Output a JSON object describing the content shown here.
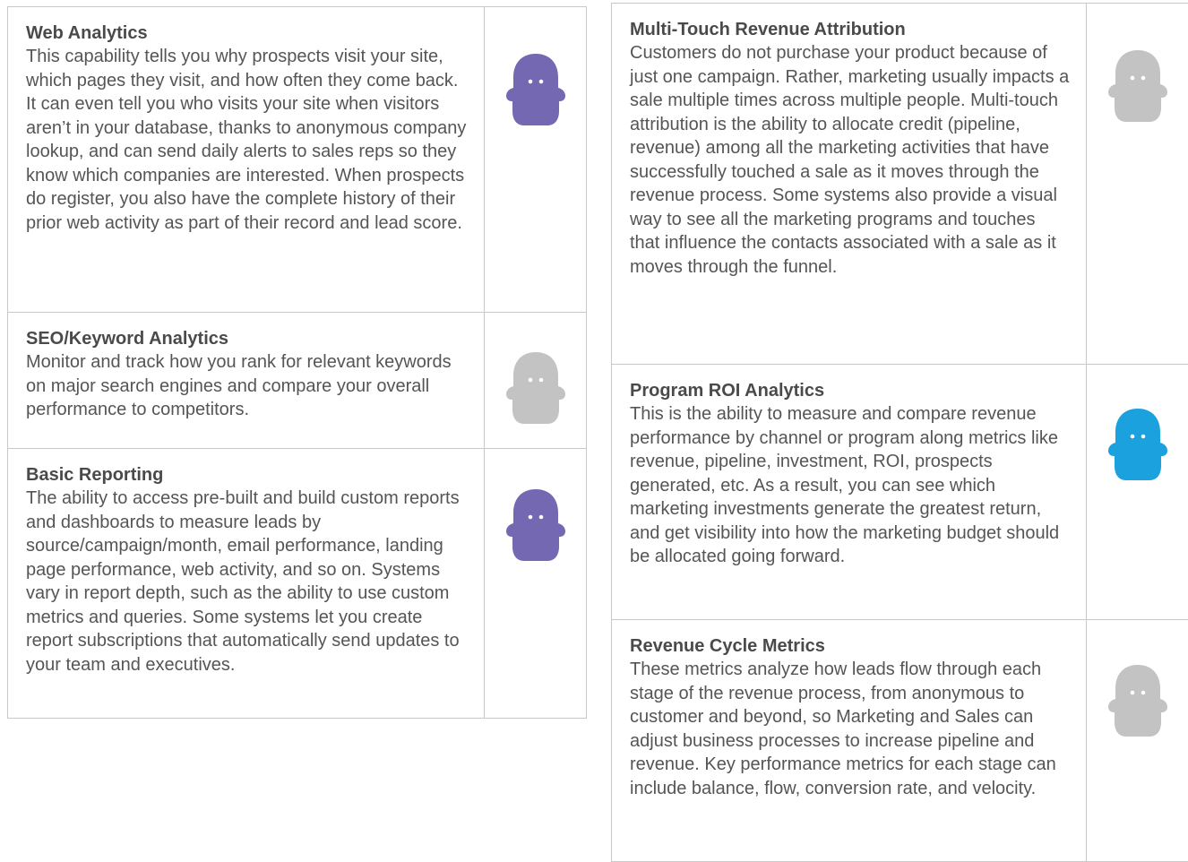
{
  "colors": {
    "purple": "#7468b2",
    "gray": "#c3c3c3",
    "blue": "#1ba1dd"
  },
  "left": [
    {
      "title": "Web Analytics",
      "desc": "This capability tells you why prospects visit your site, which pages they visit, and how often they come back. It can even tell you who visits your site when visitors aren’t in your database, thanks to anonymous company lookup, and can send daily alerts to sales reps so they know which companies are interested. When prospects do register, you also have the complete history of their prior web activity as part of their record and lead score.",
      "icon": "ghost-icon",
      "icon_color": "purple"
    },
    {
      "title": "SEO/Keyword Analytics",
      "desc": "Monitor and track how you rank for relevant keywords on major search engines and compare your overall performance to competitors.",
      "icon": "ghost-icon",
      "icon_color": "gray"
    },
    {
      "title": "Basic Reporting",
      "desc": "The ability to access pre-built and build custom reports and dashboards to measure leads by source/campaign/month, email performance, landing page performance, web activity, and so on. Systems vary in report depth, such as the ability to use custom metrics and queries. Some systems let you create report subscriptions that automatically send updates to your team and executives.",
      "icon": "ghost-icon",
      "icon_color": "purple"
    }
  ],
  "right": [
    {
      "title": "Multi-Touch Revenue Attribution",
      "desc": "Customers do not purchase your product because of just one campaign. Rather, marketing usually impacts a sale multiple times across multiple people. Multi-touch attribution is the ability to allocate credit (pipeline, revenue) among all the marketing activities that have successfully touched a sale as it moves through the revenue process. Some systems also provide a visual way to see all the marketing programs and touches that influence the contacts associated with a sale as it moves through the funnel.",
      "icon": "ghost-icon",
      "icon_color": "gray"
    },
    {
      "title": "Program ROI Analytics",
      "desc": "This is the ability to measure and compare revenue performance by channel or program along metrics like revenue, pipeline, investment, ROI, prospects generated, etc. As a result, you can see which marketing investments generate the greatest return, and get visibility into how the marketing budget should be allocated going forward.",
      "icon": "ghost-icon",
      "icon_color": "blue"
    },
    {
      "title": "Revenue Cycle Metrics",
      "desc": "These metrics analyze how leads flow through each stage of the revenue process, from anonymous to customer and beyond, so Marketing and Sales can adjust business processes to increase pipeline and revenue. Key performance metrics for each stage can include balance, flow, conversion rate, and velocity.",
      "icon": "ghost-icon",
      "icon_color": "gray"
    }
  ]
}
